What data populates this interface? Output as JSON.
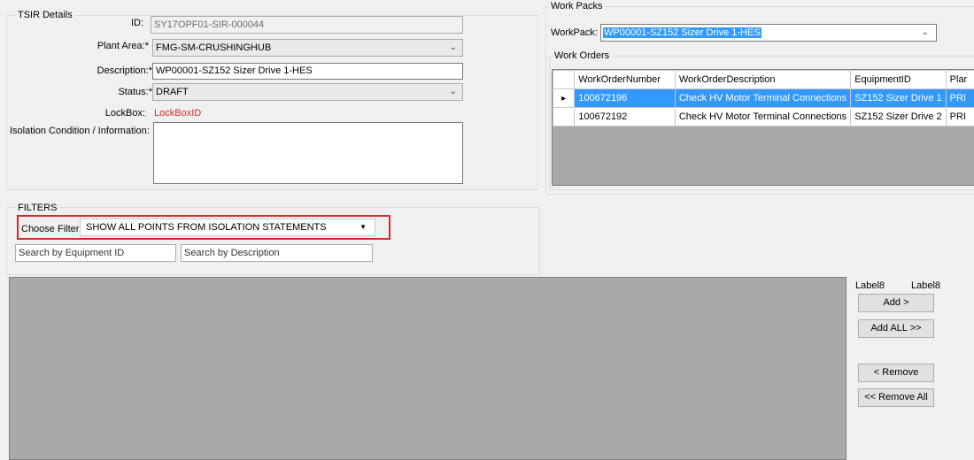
{
  "tsir": {
    "legend": "TSIR Details",
    "id_label": "ID:",
    "id_value": "SY17OPF01-SIR-000044",
    "plant_area_label": "Plant Area:*",
    "plant_area_value": "FMG-SM-CRUSHINGHUB",
    "description_label": "Description:*",
    "description_value": "WP00001-SZ152 Sizer Drive 1-HES",
    "status_label": "Status:*",
    "status_value": "DRAFT",
    "lockbox_label": "LockBox:",
    "lockbox_value": "LockBoxID",
    "isolation_label": "Isolation Condition / Information:",
    "isolation_value": ""
  },
  "work_packs": {
    "legend": "Work Packs",
    "workpack_label": "WorkPack:",
    "workpack_value": "WP00001-SZ152 Sizer Drive 1-HES"
  },
  "work_orders": {
    "legend": "Work Orders",
    "columns": [
      "WorkOrderNumber",
      "WorkOrderDescription",
      "EquipmentID",
      "Plar"
    ],
    "rows": [
      {
        "number": "100672196",
        "description": "Check HV Motor Terminal Connections",
        "equipment": "SZ152 Sizer Drive 1",
        "plant": "PRI"
      },
      {
        "number": "100672192",
        "description": "Check HV Motor Terminal Connections",
        "equipment": "SZ152 Sizer Drive 2",
        "plant": "PRI"
      }
    ],
    "row_indicator": "▸"
  },
  "filters": {
    "legend": "FILTERS",
    "choose_label": "Choose Filter:",
    "choose_value": "SHOW ALL POINTS FROM ISOLATION STATEMENTS",
    "search_equipment_placeholder": "Search by Equipment ID",
    "search_description_placeholder": "Search by Description"
  },
  "actions": {
    "label_a": "Label8",
    "label_b": "Label8",
    "add": "Add >",
    "add_all": "Add ALL >>",
    "remove": "< Remove",
    "remove_all": "<< Remove All"
  },
  "colors": {
    "selection": "#3399ff",
    "highlight_box": "#e0242b",
    "lockbox_text": "#e0242b"
  }
}
